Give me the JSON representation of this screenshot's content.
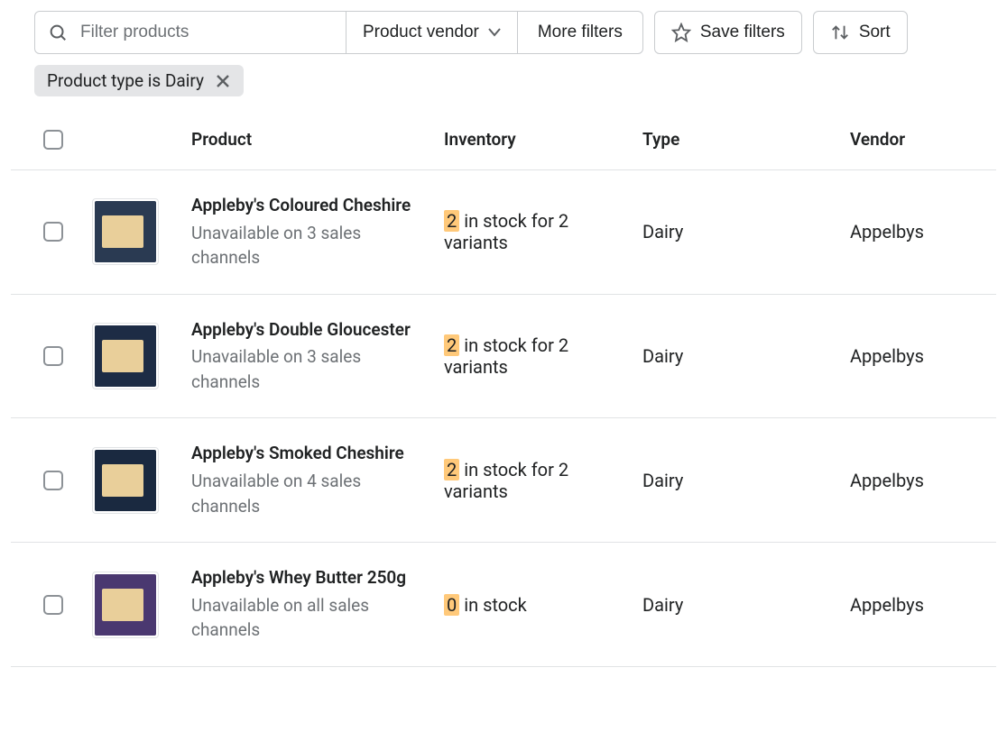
{
  "toolbar": {
    "search_placeholder": "Filter products",
    "vendor_label": "Product vendor",
    "more_filters_label": "More filters",
    "save_filters_label": "Save filters",
    "sort_label": "Sort"
  },
  "filter_chip": {
    "label": "Product type is Dairy"
  },
  "columns": {
    "product": "Product",
    "inventory": "Inventory",
    "type": "Type",
    "vendor": "Vendor"
  },
  "rows": [
    {
      "name": "Appleby's Coloured Cheshire",
      "subtitle": "Unavailable on 3 sales channels",
      "stock_count": "2",
      "stock_rest": " in stock for 2 variants",
      "type": "Dairy",
      "vendor": "Appelbys",
      "thumb_class": "tc1"
    },
    {
      "name": "Appleby's Double Gloucester",
      "subtitle": "Unavailable on 3 sales channels",
      "stock_count": "2",
      "stock_rest": " in stock for 2 variants",
      "type": "Dairy",
      "vendor": "Appelbys",
      "thumb_class": "tc2"
    },
    {
      "name": "Appleby's Smoked Cheshire",
      "subtitle": "Unavailable on 4 sales channels",
      "stock_count": "2",
      "stock_rest": " in stock for 2 variants",
      "type": "Dairy",
      "vendor": "Appelbys",
      "thumb_class": "tc3"
    },
    {
      "name": "Appleby's Whey Butter 250g",
      "subtitle": "Unavailable on all sales channels",
      "stock_count": "0",
      "stock_rest": " in stock",
      "type": "Dairy",
      "vendor": "Appelbys",
      "thumb_class": "tc4"
    }
  ]
}
